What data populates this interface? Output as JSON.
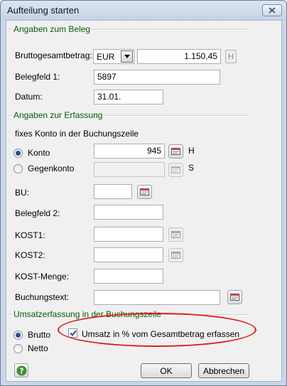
{
  "window": {
    "title": "Aufteilung starten"
  },
  "beleg": {
    "section_title": "Angaben zum Beleg",
    "bruttogesamtbetrag_label": "Bruttogesamtbetrag:",
    "currency": "EUR",
    "amount": "1.150,45",
    "amount_suffix": "H",
    "belegfeld1_label": "Belegfeld 1:",
    "belegfeld1_value": "5897",
    "datum_label": "Datum:",
    "datum_value": "31.01."
  },
  "erfassung": {
    "section_title": "Angaben zur Erfassung",
    "fixes_konto_label": "fixes Konto in der Buchungszeile",
    "konto_label": "Konto",
    "konto_value": "945",
    "konto_suffix": "H",
    "gegenkonto_label": "Gegenkonto",
    "gegenkonto_value": "",
    "gegenkonto_suffix": "S",
    "bu_label": "BU:",
    "bu_value": "",
    "belegfeld2_label": "Belegfeld 2:",
    "belegfeld2_value": "",
    "kost1_label": "KOST1:",
    "kost1_value": "",
    "kost2_label": "KOST2:",
    "kost2_value": "",
    "kost_menge_label": "KOST-Menge:",
    "kost_menge_value": "",
    "buchungstext_label": "Buchungstext:",
    "buchungstext_value": "",
    "selected": "Konto"
  },
  "umsatz": {
    "section_title": "Umsatzerfassung in der Buchungszeile",
    "brutto_label": "Brutto",
    "netto_label": "Netto",
    "selected": "Brutto",
    "percent_checkbox_label": "Umsatz in % vom Gesamtbetrag erfassen",
    "percent_checked": true
  },
  "footer": {
    "ok_label": "OK",
    "cancel_label": "Abbrechen"
  },
  "colors": {
    "section_title": "#0a5a0a",
    "annotation_oval": "#e01b1b",
    "help_icon": "#3f8f2f"
  }
}
